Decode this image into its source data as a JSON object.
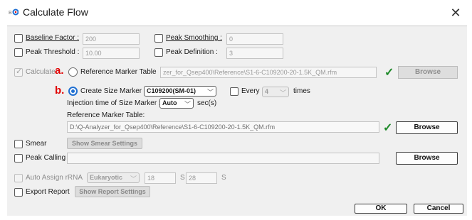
{
  "window": {
    "title": "Calculate Flow",
    "app_icon": "app-logo-icon",
    "close_glyph": "✕"
  },
  "options": {
    "baseline_factor": {
      "label": "Baseline Factor :",
      "value": "200",
      "checked": false
    },
    "peak_smoothing": {
      "label": "Peak Smoothing :",
      "value": "0",
      "checked": false
    },
    "peak_threshold": {
      "label": "Peak Threshold :",
      "value": "10.00",
      "checked": false
    },
    "peak_definition": {
      "label": "Peak Definition :",
      "value": "3",
      "checked": false
    }
  },
  "calculate": {
    "label": "Calculate",
    "checked": true,
    "marker_a": "a.",
    "reference_radio_label": "Reference Marker Table",
    "reference_path": "zer_for_Qsep400\\Reference\\S1-6-C109200-20-1.5K_QM.rfm",
    "browse_label": "Browse"
  },
  "size_marker": {
    "marker_b": "b.",
    "radio_label": "Create Size Marker",
    "selected": "C109200(SM-01)",
    "every_label": "Every",
    "every_value": "4",
    "times_label": "times",
    "injection_label": "Injection time of Size Marker :",
    "injection_value": "Auto",
    "injection_unit": "sec(s)",
    "ref_table_label": "Reference Marker Table:",
    "ref_table_path": "D:\\Q-Analyzer_for_Qsep400\\Reference\\S1-6-C109200-20-1.5K_QM.rfm",
    "browse_label": "Browse"
  },
  "smear": {
    "label": "Smear",
    "button": "Show Smear Settings"
  },
  "peak_calling": {
    "label": "Peak Calling",
    "value": "",
    "browse_label": "Browse"
  },
  "auto_assign": {
    "label": "Auto Assign rRNA",
    "type_value": "Eukaryotic",
    "val1": "18",
    "unit1": "S",
    "val2": "28",
    "unit2": "S"
  },
  "export": {
    "label": "Export Report",
    "button": "Show Report Settings"
  },
  "footer": {
    "ok": "OK",
    "cancel": "Cancel"
  },
  "colors": {
    "accent": "#1f6fd1",
    "marker": "#e00000",
    "valid_check": "#1f8a2a"
  }
}
